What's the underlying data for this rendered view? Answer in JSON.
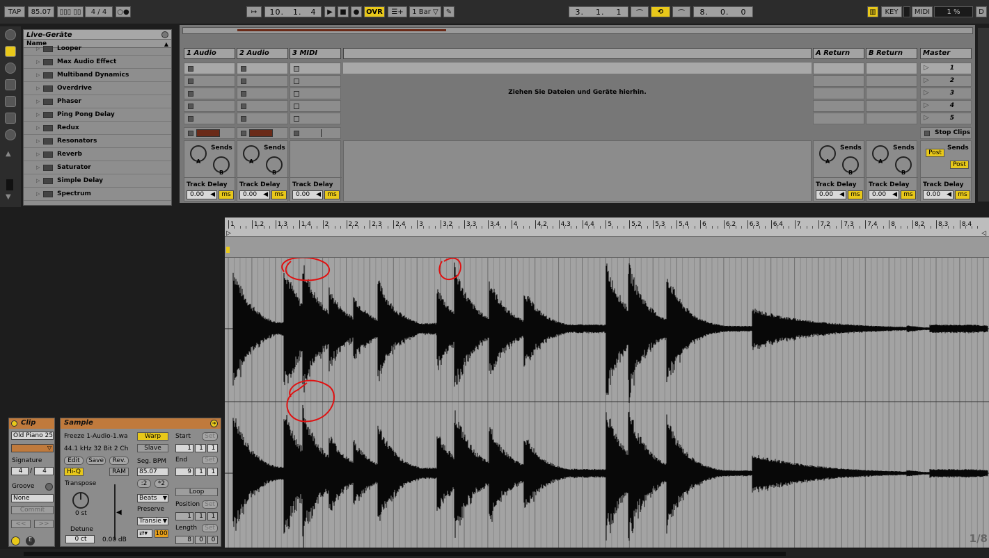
{
  "transport": {
    "tap": "TAP",
    "tempo": "85.07",
    "signature": "4 / 4",
    "position": [
      "10.",
      "1.",
      "4"
    ],
    "ovr": "OVR",
    "quant": "1 Bar",
    "loop_start": [
      "3.",
      "1.",
      "1"
    ],
    "loop_length": [
      "8.",
      "0.",
      "0"
    ],
    "key": "KEY",
    "midi": "MIDI",
    "cpu": "1 %",
    "d": "D"
  },
  "browser": {
    "title": "Live-Geräte",
    "col_name": "Name",
    "items": [
      "Looper",
      "Max Audio Effect",
      "Multiband Dynamics",
      "Overdrive",
      "Phaser",
      "Ping Pong Delay",
      "Redux",
      "Resonators",
      "Reverb",
      "Saturator",
      "Simple Delay",
      "Spectrum"
    ]
  },
  "session": {
    "tracks": [
      "1 Audio",
      "2 Audio",
      "3 MIDI"
    ],
    "returns": [
      "A Return",
      "B Return"
    ],
    "master": "Master",
    "scenes": [
      "1",
      "2",
      "3",
      "4",
      "5"
    ],
    "drop_hint": "Ziehen Sie Dateien und Geräte hierhin.",
    "stop_clips": "Stop Clips",
    "sends": "Sends",
    "knob_a": "A",
    "knob_b": "B",
    "track_delay": "Track Delay",
    "delay_value": "0.00",
    "delay_unit": "ms",
    "post": "Post"
  },
  "clip": {
    "title": "Clip",
    "name": "Old Piano 25",
    "signature_label": "Signature",
    "sig_num": "4",
    "sig_sep": "/",
    "sig_den": "4",
    "groove_label": "Groove",
    "groove_value": "None",
    "commit": "Commit"
  },
  "sample": {
    "title": "Sample",
    "file": "Freeze 1-Audio-1.wa",
    "format": "44.1 kHz 32 Bit 2 Ch",
    "edit": "Edit",
    "save": "Save",
    "rev": "Rev.",
    "hiq": "Hi-Q",
    "ram": "RAM",
    "transpose_label": "Transpose",
    "transpose_value": "0 st",
    "detune_label": "Detune",
    "detune_value": "0 ct",
    "gain_value": "0.00 dB",
    "warp": "Warp",
    "slave": "Slave",
    "seg_bpm_label": "Seg. BPM",
    "seg_bpm": "85.07",
    "half": ":2",
    "double": "*2",
    "mode": "Beats",
    "preserve_label": "Preserve",
    "preserve": "Transie",
    "envelope": "100",
    "start_label": "Start",
    "end_label": "End",
    "set": "Set",
    "start": [
      "1",
      "1",
      "1"
    ],
    "end": [
      "9",
      "1",
      "1"
    ],
    "loop": "Loop",
    "position_label": "Position",
    "position": [
      "1",
      "1",
      "1"
    ],
    "length_label": "Length",
    "length": [
      "8",
      "0",
      "0"
    ]
  },
  "ruler": {
    "ticks": [
      "1",
      "1.2",
      "1.3",
      "1.4",
      "2",
      "2.2",
      "2.3",
      "2.4",
      "3",
      "3.2",
      "3.3",
      "3.4",
      "4",
      "4.2",
      "4.3",
      "4.4",
      "5",
      "5.2",
      "5.3",
      "5.4",
      "6",
      "6.2",
      "6.3",
      "6.4",
      "7",
      "7.2",
      "7.3",
      "7.4",
      "8",
      "8.2",
      "8.3",
      "8.4"
    ]
  },
  "zoom_label": "1/8",
  "colors": {
    "accent_yellow": "#e8c81a",
    "clip_orange": "#c07a3c",
    "annotation_red": "#e01010"
  }
}
